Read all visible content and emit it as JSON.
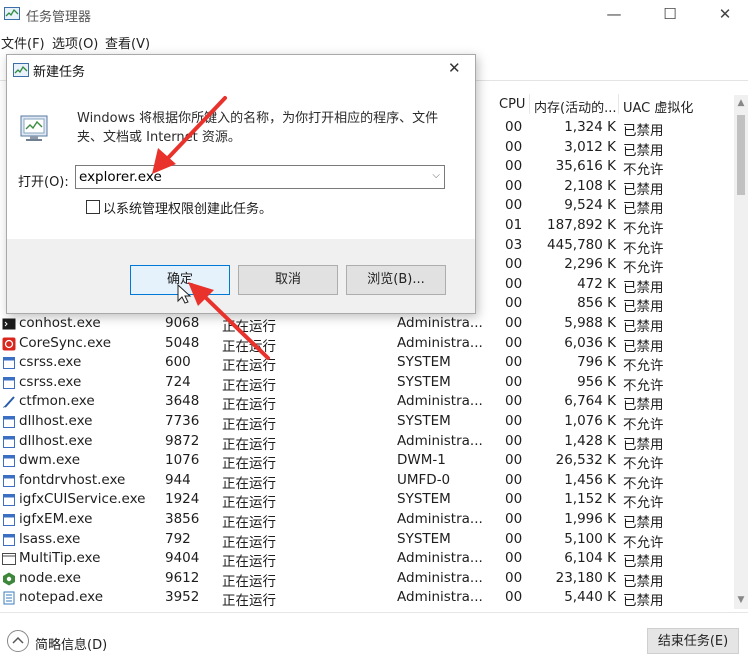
{
  "window": {
    "title": "任务管理器",
    "minimize": "—",
    "maximize": "☐",
    "close": "✕"
  },
  "menu": [
    "文件(F)",
    "选项(O)",
    "查看(V)"
  ],
  "columns": {
    "cpu": "CPU",
    "memory": "内存(活动的...",
    "uac": "UAC 虚拟化"
  },
  "background_rows": [
    {
      "cpu": "00",
      "mem": "1,324 K",
      "uac": "已禁用"
    },
    {
      "cpu": "00",
      "mem": "3,012 K",
      "uac": "已禁用"
    },
    {
      "cpu": "00",
      "mem": "35,616 K",
      "uac": "不允许"
    },
    {
      "cpu": "00",
      "mem": "2,108 K",
      "uac": "已禁用"
    },
    {
      "cpu": "00",
      "mem": "9,524 K",
      "uac": "已禁用"
    },
    {
      "cpu": "01",
      "mem": "187,892 K",
      "uac": "不允许"
    },
    {
      "cpu": "03",
      "mem": "445,780 K",
      "uac": "不允许"
    },
    {
      "cpu": "00",
      "mem": "2,296 K",
      "uac": "不允许"
    },
    {
      "cpu": "00",
      "mem": "472 K",
      "uac": "已禁用"
    },
    {
      "cpu": "00",
      "mem": "856 K",
      "uac": "已禁用"
    }
  ],
  "processes": [
    {
      "name": "conhost.exe",
      "pid": "9068",
      "status": "正在运行",
      "user": "Administra...",
      "cpu": "00",
      "mem": "5,988 K",
      "uac": "已禁用",
      "icon": "console-icon",
      "color": "#1b1b1b"
    },
    {
      "name": "CoreSync.exe",
      "pid": "5048",
      "status": "正在运行",
      "user": "Administra...",
      "cpu": "00",
      "mem": "6,036 K",
      "uac": "已禁用",
      "icon": "adobe-sync-icon",
      "color": "#d9251c"
    },
    {
      "name": "csrss.exe",
      "pid": "600",
      "status": "正在运行",
      "user": "SYSTEM",
      "cpu": "00",
      "mem": "796 K",
      "uac": "不允许",
      "icon": "app-window-icon",
      "color": "#3a6fc4"
    },
    {
      "name": "csrss.exe",
      "pid": "724",
      "status": "正在运行",
      "user": "SYSTEM",
      "cpu": "00",
      "mem": "956 K",
      "uac": "不允许",
      "icon": "app-window-icon",
      "color": "#3a6fc4"
    },
    {
      "name": "ctfmon.exe",
      "pid": "3648",
      "status": "正在运行",
      "user": "Administra...",
      "cpu": "00",
      "mem": "6,764 K",
      "uac": "已禁用",
      "icon": "pen-icon",
      "color": "#2a5da8"
    },
    {
      "name": "dllhost.exe",
      "pid": "7736",
      "status": "正在运行",
      "user": "SYSTEM",
      "cpu": "00",
      "mem": "1,076 K",
      "uac": "不允许",
      "icon": "app-window-icon",
      "color": "#3a6fc4"
    },
    {
      "name": "dllhost.exe",
      "pid": "9872",
      "status": "正在运行",
      "user": "Administra...",
      "cpu": "00",
      "mem": "1,428 K",
      "uac": "已禁用",
      "icon": "app-window-icon",
      "color": "#3a6fc4"
    },
    {
      "name": "dwm.exe",
      "pid": "1076",
      "status": "正在运行",
      "user": "DWM-1",
      "cpu": "00",
      "mem": "26,532 K",
      "uac": "不允许",
      "icon": "app-window-icon",
      "color": "#3a6fc4"
    },
    {
      "name": "fontdrvhost.exe",
      "pid": "944",
      "status": "正在运行",
      "user": "UMFD-0",
      "cpu": "00",
      "mem": "1,456 K",
      "uac": "不允许",
      "icon": "app-window-icon",
      "color": "#3a6fc4"
    },
    {
      "name": "igfxCUIService.exe",
      "pid": "1924",
      "status": "正在运行",
      "user": "SYSTEM",
      "cpu": "00",
      "mem": "1,152 K",
      "uac": "不允许",
      "icon": "app-window-icon",
      "color": "#3a6fc4"
    },
    {
      "name": "igfxEM.exe",
      "pid": "3856",
      "status": "正在运行",
      "user": "Administra...",
      "cpu": "00",
      "mem": "1,996 K",
      "uac": "已禁用",
      "icon": "app-window-icon",
      "color": "#3a6fc4"
    },
    {
      "name": "lsass.exe",
      "pid": "792",
      "status": "正在运行",
      "user": "SYSTEM",
      "cpu": "00",
      "mem": "5,100 K",
      "uac": "不允许",
      "icon": "app-window-icon",
      "color": "#3a6fc4"
    },
    {
      "name": "MultiTip.exe",
      "pid": "9404",
      "status": "正在运行",
      "user": "Administra...",
      "cpu": "00",
      "mem": "6,104 K",
      "uac": "已禁用",
      "icon": "window-frame-icon",
      "color": "#4a4a4a"
    },
    {
      "name": "node.exe",
      "pid": "9612",
      "status": "正在运行",
      "user": "Administra...",
      "cpu": "00",
      "mem": "23,180 K",
      "uac": "已禁用",
      "icon": "node-icon",
      "color": "#3c873a"
    },
    {
      "name": "notepad.exe",
      "pid": "3952",
      "status": "正在运行",
      "user": "Administra...",
      "cpu": "00",
      "mem": "5,440 K",
      "uac": "已禁用",
      "icon": "notepad-icon",
      "color": "#3b7bbf"
    }
  ],
  "run_dialog": {
    "title": "新建任务",
    "close": "✕",
    "description": "Windows 将根据你所键入的名称，为你打开相应的程序、文件夹、文档或 Internet 资源。",
    "open_label": "打开(O):",
    "open_value": "explorer.exe",
    "admin_checkbox": "以系统管理权限创建此任务。",
    "ok": "确定",
    "cancel": "取消",
    "browse": "浏览(B)..."
  },
  "footer": {
    "fewer_details": "简略信息(D)",
    "end_task": "结束任务(E)"
  },
  "colors": {
    "annotation_arrow": "#e8322b",
    "primary_button_border": "#0078d7"
  }
}
